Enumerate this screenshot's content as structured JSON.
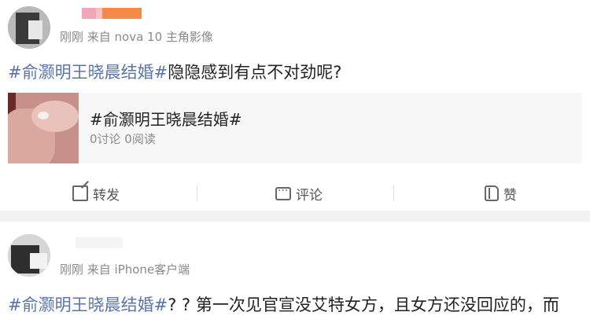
{
  "colors": {
    "hashtag": "#5a74a8",
    "meta": "#8a8a8a",
    "background": "#f2f2f2",
    "card_bg": "#f7f7f7"
  },
  "posts": [
    {
      "meta": "刚刚 来自 nova 10 主角影像",
      "hashtag": "#俞灏明王晓晨结婚#",
      "text": "隐隐感到有点不对劲呢?",
      "card": {
        "title": "#俞灏明王晓晨结婚#",
        "stats": "0讨论 0阅读"
      },
      "actions": {
        "repost": "转发",
        "comment": "评论",
        "like": "赞"
      }
    },
    {
      "meta": "刚刚 来自 iPhone客户端",
      "hashtag": "#俞灏明王晓晨结婚#",
      "text": "? ? 第一次见官宣没艾特女方，且女方还没回应的，而"
    }
  ]
}
